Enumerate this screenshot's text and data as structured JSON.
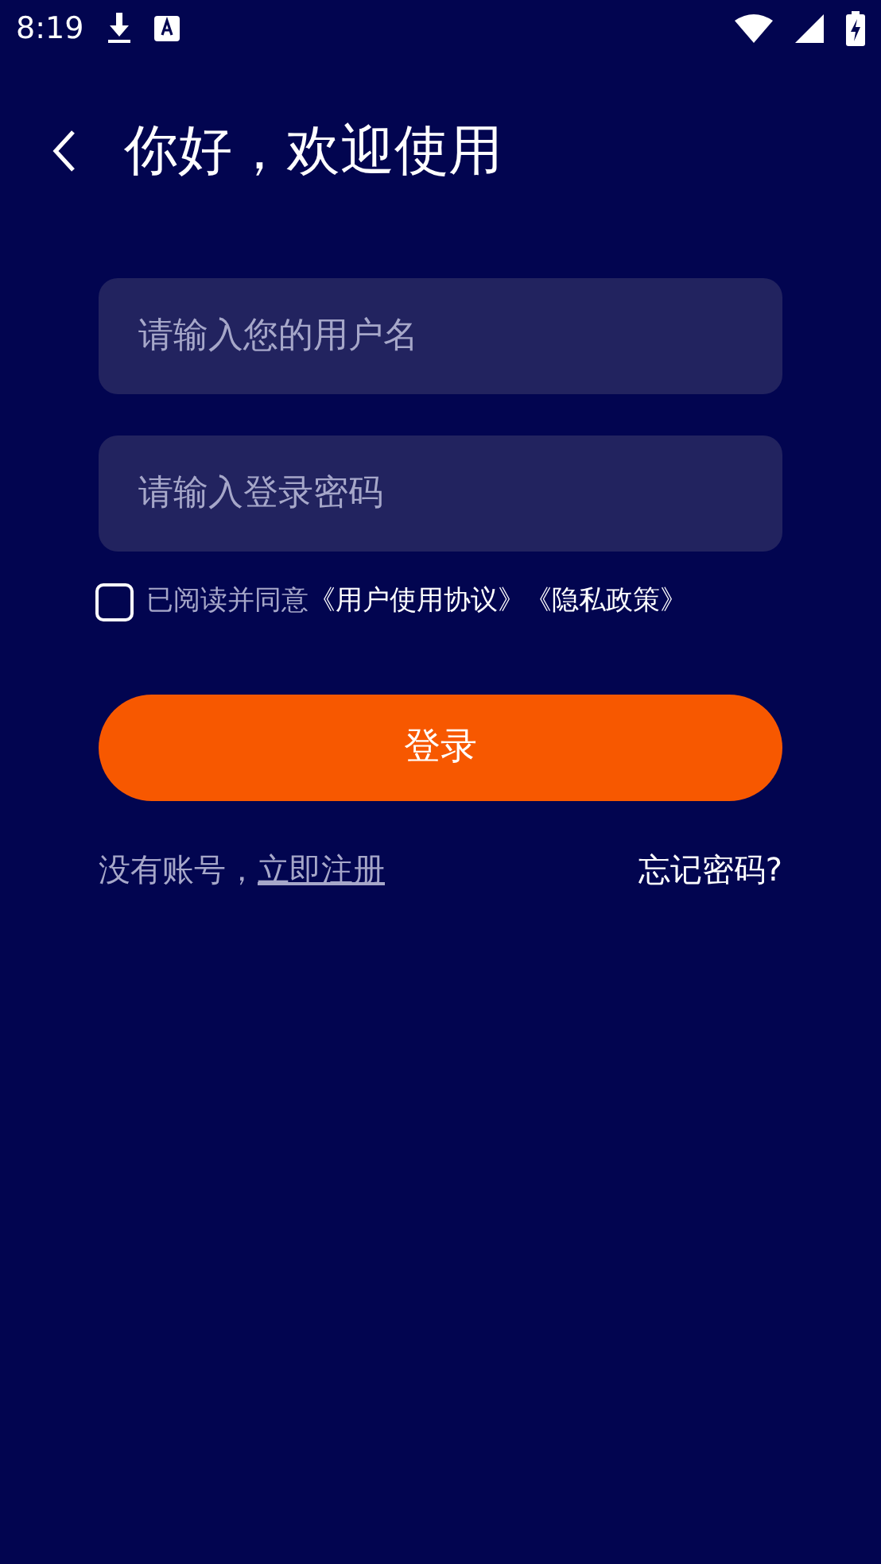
{
  "status_bar": {
    "time": "8:19"
  },
  "header": {
    "title": "你好，欢迎使用"
  },
  "fields": [
    {
      "placeholder": "请输入您的用户名"
    },
    {
      "placeholder": "请输入登录密码"
    }
  ],
  "agreement": {
    "checked": false,
    "text": "已阅读并同意",
    "links": [
      "《用户使用协议》",
      "《隐私政策》"
    ]
  },
  "login_button": "登录",
  "footer": {
    "prompt": "没有账号，",
    "register": "立即注册",
    "forgot": "忘记密码?"
  }
}
